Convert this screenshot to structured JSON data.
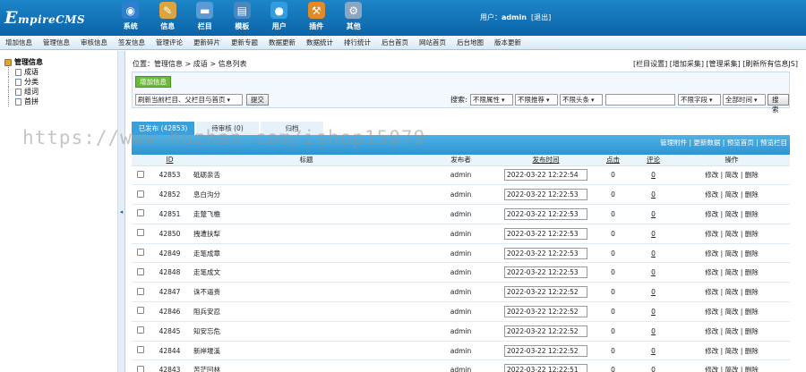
{
  "app": {
    "logo_initial": "E",
    "logo_rest": "mpireCMS"
  },
  "main_nav": [
    {
      "label": "系统",
      "icon": "globe-icon",
      "color": "#2f7fd0"
    },
    {
      "label": "信息",
      "icon": "document-pen-icon",
      "color": "#d9a441"
    },
    {
      "label": "栏目",
      "icon": "folder-icon",
      "color": "#5b9bd5"
    },
    {
      "label": "模板",
      "icon": "template-icon",
      "color": "#4a86c2"
    },
    {
      "label": "用户",
      "icon": "user-icon",
      "color": "#2f9de0"
    },
    {
      "label": "插件",
      "icon": "tools-icon",
      "color": "#e08a2a"
    },
    {
      "label": "其他",
      "icon": "gear-icon",
      "color": "#8aa6c2"
    }
  ],
  "user": {
    "prefix": "用户：",
    "name": "admin",
    "logout": "[退出]"
  },
  "sub_nav": [
    "增加信息",
    "管理信息",
    "审核信息",
    "签发信息",
    "管理评论",
    "更新碎片",
    "更新专题",
    "数据更新",
    "数据统计",
    "排行统计",
    "后台首页",
    "网站首页",
    "后台地图",
    "版本更新"
  ],
  "tree": {
    "root": "管理信息",
    "items": [
      "成语",
      "分类",
      "组词",
      "首拼"
    ]
  },
  "breadcrumb": "位置：管理信息 > 成语 > 信息列表",
  "top_links": "[栏目设置] [增加采集] [管理采集] [刷新所有信息JS]",
  "toolbar": {
    "add_button": "增加信息",
    "refresh_select": "刷新当前栏目、父栏目与首页",
    "submit": "提交",
    "search_label": "搜索:",
    "attr": "不限属性",
    "recommend": "不限推荐",
    "headline": "不限头条",
    "field": "不限字段",
    "time": "全部时间",
    "search_button": "搜索"
  },
  "tabs": [
    "已发布 (42853)",
    "待审核 (0)",
    "归档"
  ],
  "table_links": "管理附件 | 更新数据 | 预览首页 | 预览栏目",
  "columns": {
    "id": "ID",
    "title": "标题",
    "publisher": "发布者",
    "time": "发布时间",
    "clicks": "点击",
    "comments": "评论",
    "ops": "操作"
  },
  "rows": [
    {
      "id": "42853",
      "title": "砥砺亲舌",
      "publisher": "admin",
      "time": "2022-03-22 12:22:54",
      "clicks": "0",
      "comments": "0",
      "ops": "修改 | 简改 | 删除"
    },
    {
      "id": "42852",
      "title": "息白沟分",
      "publisher": "admin",
      "time": "2022-03-22 12:22:53",
      "clicks": "0",
      "comments": "0",
      "ops": "修改 | 简改 | 删除"
    },
    {
      "id": "42851",
      "title": "走蹩飞檐",
      "publisher": "admin",
      "time": "2022-03-22 12:22:53",
      "clicks": "0",
      "comments": "0",
      "ops": "修改 | 简改 | 删除"
    },
    {
      "id": "42850",
      "title": "拽遭扶犁",
      "publisher": "admin",
      "time": "2022-03-22 12:22:53",
      "clicks": "0",
      "comments": "0",
      "ops": "修改 | 简改 | 删除"
    },
    {
      "id": "42849",
      "title": "走笔成章",
      "publisher": "admin",
      "time": "2022-03-22 12:22:53",
      "clicks": "0",
      "comments": "0",
      "ops": "修改 | 简改 | 删除"
    },
    {
      "id": "42848",
      "title": "走笔成文",
      "publisher": "admin",
      "time": "2022-03-22 12:22:53",
      "clicks": "0",
      "comments": "0",
      "ops": "修改 | 简改 | 删除"
    },
    {
      "id": "42847",
      "title": "诛不逼贵",
      "publisher": "admin",
      "time": "2022-03-22 12:22:52",
      "clicks": "0",
      "comments": "0",
      "ops": "修改 | 简改 | 删除"
    },
    {
      "id": "42846",
      "title": "阻兵安忍",
      "publisher": "admin",
      "time": "2022-03-22 12:22:52",
      "clicks": "0",
      "comments": "0",
      "ops": "修改 | 简改 | 删除"
    },
    {
      "id": "42845",
      "title": "知安忘危",
      "publisher": "admin",
      "time": "2022-03-22 12:22:52",
      "clicks": "0",
      "comments": "0",
      "ops": "修改 | 简改 | 删除"
    },
    {
      "id": "42844",
      "title": "新岸堰溪",
      "publisher": "admin",
      "time": "2022-03-22 12:22:52",
      "clicks": "0",
      "comments": "0",
      "ops": "修改 | 简改 | 删除"
    },
    {
      "id": "42843",
      "title": "苦茫回林",
      "publisher": "admin",
      "time": "2022-03-22 12:22:51",
      "clicks": "0",
      "comments": "0",
      "ops": "修改 | 简改 | 删除"
    }
  ],
  "watermark": "https://www.huzhan.com/ishop15079"
}
